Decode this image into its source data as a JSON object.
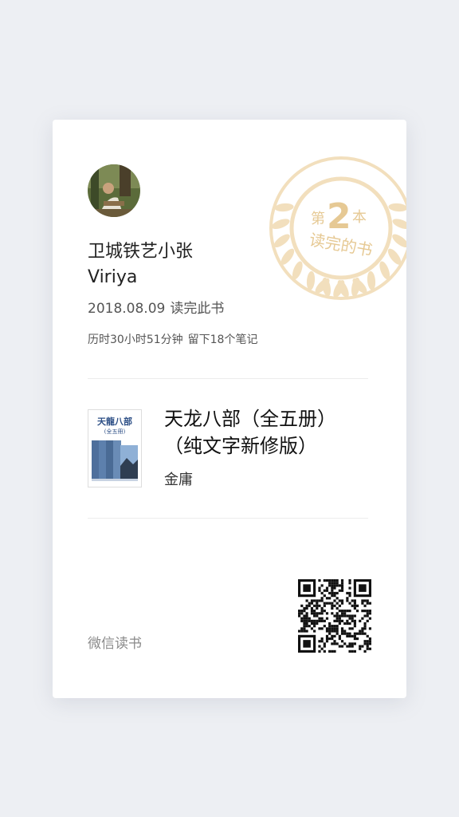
{
  "medal": {
    "prefix": "第",
    "number": "2",
    "suffix": "本",
    "caption": "读完的书",
    "color": "#e8cfa0"
  },
  "user": {
    "name": "卫城铁艺小张",
    "nickname": "Viriya",
    "avatar_icon": "user-avatar-photo"
  },
  "reading": {
    "date": "2018.08.09",
    "finish_text": "读完此书",
    "duration_text": "历时30小时51分钟",
    "notes_text": "留下18个笔记"
  },
  "book": {
    "title_line1": "天龙八部（全五册）",
    "title_line2": "（纯文字新修版）",
    "author": "金庸",
    "cover_title": "天龍八部",
    "cover_subtitle": "(全五冊)"
  },
  "footer": {
    "brand": "微信读书",
    "qr_icon": "qr-code-icon"
  }
}
